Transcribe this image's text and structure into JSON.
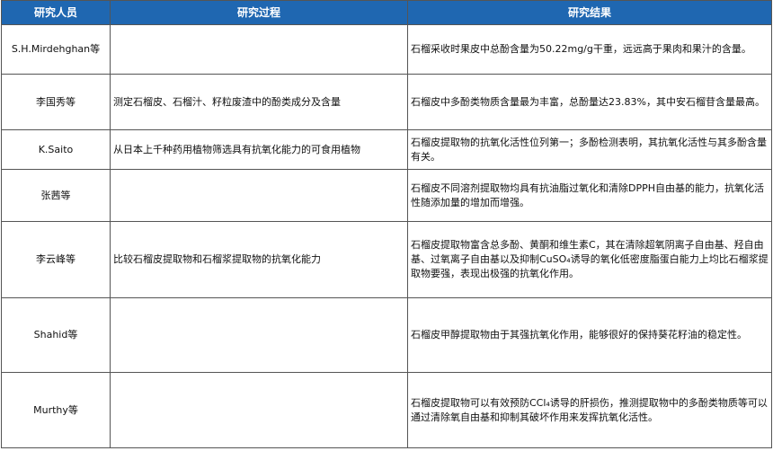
{
  "table": {
    "headers": [
      "研究人员",
      "研究过程",
      "研究结果"
    ],
    "rows": [
      {
        "researcher": "S.H.Mirdehghan等",
        "process": "",
        "result": "石榴采收时果皮中总酚含量为50.22mg/g干重，远远高于果肉和果汁的含量。"
      },
      {
        "researcher": "李国秀等",
        "process": "测定石榴皮、石榴汁、籽粒废渣中的酚类成分及含量",
        "result": "石榴皮中多酚类物质含量最为丰富，总酚量达23.83%，其中安石榴苷含量最高。"
      },
      {
        "researcher": "K.Saito",
        "process": "从日本上千种药用植物筛选具有抗氧化能力的可食用植物",
        "result": "石榴皮提取物的抗氧化活性位列第一；多酚检测表明，其抗氧化活性与其多酚含量有关。"
      },
      {
        "researcher": "张茜等",
        "process": "",
        "result": "石榴皮不同溶剂提取物均具有抗油脂过氧化和清除DPPH自由基的能力，抗氧化活性随添加量的增加而增强。"
      },
      {
        "researcher": "李云峰等",
        "process": "比较石榴皮提取物和石榴浆提取物的抗氧化能力",
        "result": "石榴皮提取物富含总多酚、黄酮和维生素C，其在清除超氧阴离子自由基、羟自由基、过氧离子自由基以及抑制CuSO₄诱导的氧化低密度脂蛋白能力上均比石榴浆提取物要强，表现出极强的抗氧化作用。"
      },
      {
        "researcher": "Shahid等",
        "process": "",
        "result": "石榴皮甲醇提取物由于其强抗氧化作用，能够很好的保持葵花籽油的稳定性。"
      },
      {
        "researcher": "Murthy等",
        "process": "",
        "result": "石榴皮提取物可以有效预防CCl₄诱导的肝损伤，推测提取物中的多酚类物质等可以通过清除氧自由基和抑制其破坏作用来发挥抗氧化活性。"
      }
    ]
  },
  "colors": {
    "header_bg": "#1f67b1",
    "header_text": "#ffffff",
    "border": "#555555"
  }
}
